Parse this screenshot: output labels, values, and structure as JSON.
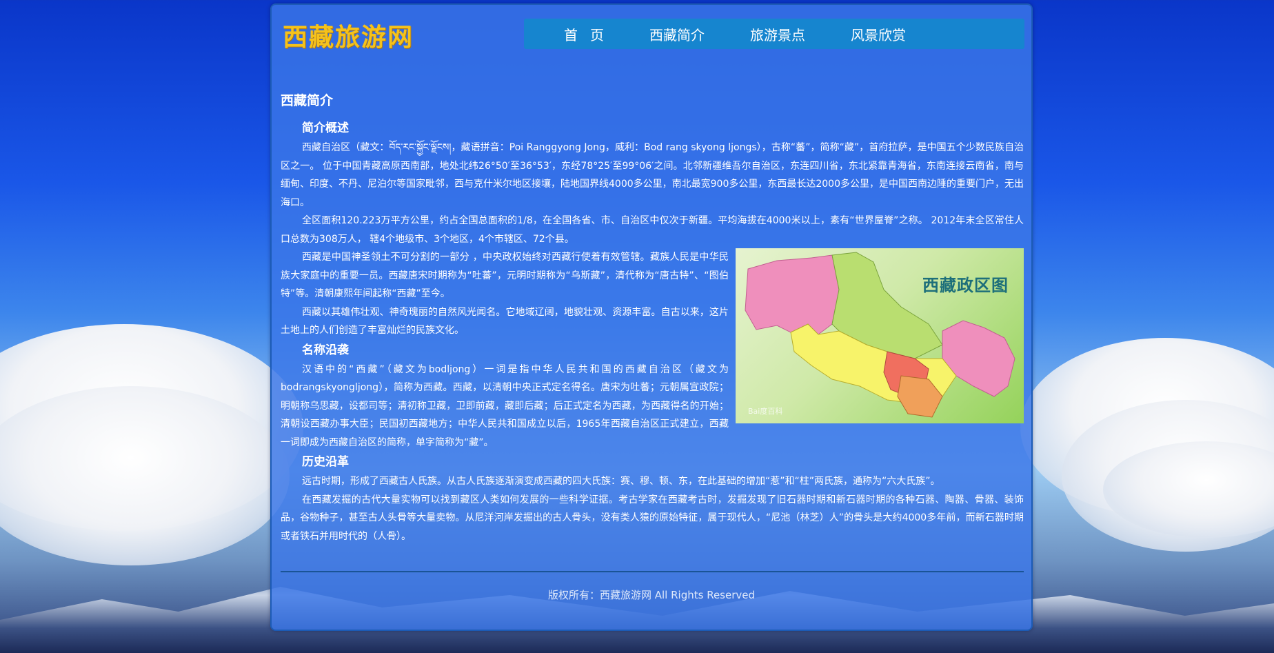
{
  "header": {
    "logo": "西藏旅游网",
    "nav": [
      {
        "label": "首页"
      },
      {
        "label": "西藏简介"
      },
      {
        "label": "旅游景点"
      },
      {
        "label": "风景欣赏"
      }
    ]
  },
  "article": {
    "title": "西藏简介",
    "sections": [
      {
        "heading": "简介概述",
        "paragraphs": [
          "西藏自治区（藏文：བོད་རང་སྐྱོང་ལྗོངས།，藏语拼音：Poi Ranggyong Jong，威利：Bod rang skyong ljongs），古称“蕃”，简称“藏”，首府拉萨，是中国五个少数民族自治区之一。 位于中国青藏高原西南部，地处北纬26°50′至36°53′，东经78°25′至99°06′之间。北邻新疆维吾尔自治区，东连四川省，东北紧靠青海省，东南连接云南省，南与缅甸、印度、不丹、尼泊尔等国家毗邻，西与克什米尔地区接壤，陆地国界线4000多公里，南北最宽900多公里，东西最长达2000多公里，是中国西南边陲的重要门户，无出海口。",
          "全区面积120.223万平方公里，约占全国总面积的1/8，在全国各省、市、自治区中仅次于新疆。平均海拔在4000米以上，素有“世界屋脊”之称。 2012年末全区常住人口总数为308万人， 辖4个地级市、3个地区，4个市辖区、72个县。",
          "西藏是中国神圣领土不可分割的一部分 ，中央政权始终对西藏行使着有效管辖。藏族人民是中华民族大家庭中的重要一员。西藏唐宋时期称为“吐蕃”，元明时期称为“乌斯藏”，清代称为“唐古特”、“图伯特”等。清朝康熙年间起称“西藏”至今。",
          "西藏以其雄伟壮观、神奇瑰丽的自然风光闻名。它地域辽阔，地貌壮观、资源丰富。自古以来，这片土地上的人们创造了丰富灿烂的民族文化。"
        ]
      },
      {
        "heading": "名称沿袭",
        "paragraphs": [
          "汉语中的“西藏”（藏文为bodljong）一词是指中华人民共和国的西藏自治区（藏文为bodrangskyongljong），简称为西藏。西藏，以清朝中央正式定名得名。唐宋为吐蕃；元朝属宣政院；明朝称乌思藏，设都司等；清初称卫藏，卫即前藏，藏即后藏；后正式定名为西藏，为西藏得名的开始；清朝设西藏办事大臣；民国初西藏地方；中华人民共和国成立以后，1965年西藏自治区正式建立，西藏一词即成为西藏自治区的简称，单字简称为“藏”。"
        ]
      },
      {
        "heading": "历史沿革",
        "paragraphs": [
          "远古时期，形成了西藏古人氏族。从古人氏族逐渐演变成西藏的四大氏族：赛、穆、顿、东，在此基础的增加“惹”和“柱”两氏族，通称为“六大氏族”。",
          "在西藏发掘的古代大量实物可以找到藏区人类如何发展的一些科学证据。考古学家在西藏考古时，发掘发现了旧石器时期和新石器时期的各种石器、陶器、骨器、装饰品，谷物种子，甚至古人头骨等大量卖物。从尼洋河岸发掘出的古人骨头，没有类人猿的原始特征，属于现代人，“尼池（林芝）人”的骨头是大约4000多年前，而新石器时期或者铁石并用时代的（人骨）。"
        ]
      }
    ],
    "map": {
      "title": "西藏政区图",
      "watermark": "Bai度百科"
    }
  },
  "footer": {
    "copyright": "版权所有：西藏旅游网 All Rights Reserved"
  },
  "colors": {
    "logo": "#f5c21b",
    "nav_bg": "#1685cf",
    "panel_bg": "#3a76e8",
    "divider": "#1a5496"
  }
}
